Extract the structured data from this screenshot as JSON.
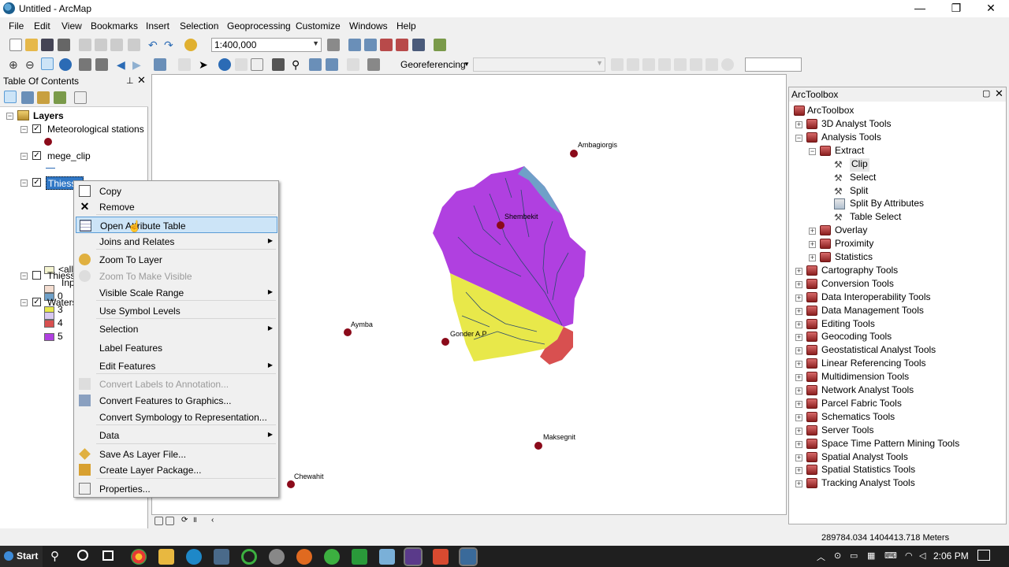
{
  "window": {
    "title": "Untitled - ArcMap",
    "minimize": "—",
    "restore": "❐",
    "close": "✕"
  },
  "menubar": [
    "File",
    "Edit",
    "View",
    "Bookmarks",
    "Insert",
    "Selection",
    "Geoprocessing",
    "Customize",
    "Windows",
    "Help"
  ],
  "toolbar": {
    "scale_value": "1:400,000",
    "georeferencing_label": "Georeferencing"
  },
  "toc": {
    "title": "Table Of Contents",
    "root": "Layers",
    "layers": [
      {
        "name": "Meteorological stations",
        "checked": true
      },
      {
        "name": "mege_clip",
        "checked": true
      },
      {
        "name": "Thiesse",
        "checked": true,
        "selected": true
      },
      {
        "name": "Thiesse",
        "checked": false
      },
      {
        "name": "Waters",
        "checked": true
      }
    ],
    "thiessen_sublabels": [
      "<all",
      "Inp"
    ],
    "legend_values": [
      "0",
      "3",
      "4",
      "5"
    ],
    "colors": {
      "v0": "#6fa0c8",
      "v3": "#e8e84a",
      "v4": "#d85050",
      "v5": "#b040e0"
    }
  },
  "context_menu": {
    "items": [
      {
        "label": "Copy",
        "icon": "copy-icon",
        "disabled": false,
        "submenu": false
      },
      {
        "label": "Remove",
        "icon": "remove-icon",
        "disabled": false,
        "submenu": false
      },
      {
        "label": "Open Attribute Table",
        "icon": "table-icon",
        "disabled": false,
        "submenu": false,
        "highlighted": true
      },
      {
        "label": "Joins and Relates",
        "icon": "",
        "disabled": false,
        "submenu": true
      },
      {
        "label": "Zoom To Layer",
        "icon": "zoom-layer-icon",
        "disabled": false,
        "submenu": false
      },
      {
        "label": "Zoom To Make Visible",
        "icon": "zoom-visible-icon",
        "disabled": true,
        "submenu": false
      },
      {
        "label": "Visible Scale Range",
        "icon": "",
        "disabled": false,
        "submenu": true
      },
      {
        "label": "Use Symbol Levels",
        "icon": "",
        "disabled": false,
        "submenu": false
      },
      {
        "label": "Selection",
        "icon": "",
        "disabled": false,
        "submenu": true
      },
      {
        "label": "Label Features",
        "icon": "",
        "disabled": false,
        "submenu": false
      },
      {
        "label": "Edit Features",
        "icon": "",
        "disabled": false,
        "submenu": true
      },
      {
        "label": "Convert Labels to Annotation...",
        "icon": "annotation-icon",
        "disabled": true,
        "submenu": false
      },
      {
        "label": "Convert Features to Graphics...",
        "icon": "graphics-icon",
        "disabled": false,
        "submenu": false
      },
      {
        "label": "Convert Symbology to Representation...",
        "icon": "",
        "disabled": false,
        "submenu": false
      },
      {
        "label": "Data",
        "icon": "",
        "disabled": false,
        "submenu": true
      },
      {
        "label": "Save As Layer File...",
        "icon": "layer-file-icon",
        "disabled": false,
        "submenu": false
      },
      {
        "label": "Create Layer Package...",
        "icon": "layer-package-icon",
        "disabled": false,
        "submenu": false
      },
      {
        "label": "Properties...",
        "icon": "properties-icon",
        "disabled": false,
        "submenu": false
      }
    ]
  },
  "map": {
    "stations": [
      "Ambagiorgis",
      "Shembekit",
      "Aymba",
      "Gonder A.P",
      "Maksegnit",
      "Chewahit"
    ]
  },
  "toolbox": {
    "title": "ArcToolbox",
    "root": "ArcToolbox",
    "items": [
      {
        "label": "3D Analyst Tools",
        "level": 1,
        "type": "toolbox",
        "expanded": false
      },
      {
        "label": "Analysis Tools",
        "level": 1,
        "type": "toolbox",
        "expanded": true
      },
      {
        "label": "Extract",
        "level": 2,
        "type": "toolset",
        "expanded": true
      },
      {
        "label": "Clip",
        "level": 3,
        "type": "tool",
        "highlight": true
      },
      {
        "label": "Select",
        "level": 3,
        "type": "tool"
      },
      {
        "label": "Split",
        "level": 3,
        "type": "tool"
      },
      {
        "label": "Split By Attributes",
        "level": 3,
        "type": "script"
      },
      {
        "label": "Table Select",
        "level": 3,
        "type": "tool"
      },
      {
        "label": "Overlay",
        "level": 2,
        "type": "toolset",
        "expanded": false
      },
      {
        "label": "Proximity",
        "level": 2,
        "type": "toolset",
        "expanded": false
      },
      {
        "label": "Statistics",
        "level": 2,
        "type": "toolset",
        "expanded": false
      },
      {
        "label": "Cartography Tools",
        "level": 1,
        "type": "toolbox",
        "expanded": false
      },
      {
        "label": "Conversion Tools",
        "level": 1,
        "type": "toolbox",
        "expanded": false
      },
      {
        "label": "Data Interoperability Tools",
        "level": 1,
        "type": "toolbox",
        "expanded": false
      },
      {
        "label": "Data Management Tools",
        "level": 1,
        "type": "toolbox",
        "expanded": false
      },
      {
        "label": "Editing Tools",
        "level": 1,
        "type": "toolbox",
        "expanded": false
      },
      {
        "label": "Geocoding Tools",
        "level": 1,
        "type": "toolbox",
        "expanded": false
      },
      {
        "label": "Geostatistical Analyst Tools",
        "level": 1,
        "type": "toolbox",
        "expanded": false
      },
      {
        "label": "Linear Referencing Tools",
        "level": 1,
        "type": "toolbox",
        "expanded": false
      },
      {
        "label": "Multidimension Tools",
        "level": 1,
        "type": "toolbox",
        "expanded": false
      },
      {
        "label": "Network Analyst Tools",
        "level": 1,
        "type": "toolbox",
        "expanded": false
      },
      {
        "label": "Parcel Fabric Tools",
        "level": 1,
        "type": "toolbox",
        "expanded": false
      },
      {
        "label": "Schematics Tools",
        "level": 1,
        "type": "toolbox",
        "expanded": false
      },
      {
        "label": "Server Tools",
        "level": 1,
        "type": "toolbox",
        "expanded": false
      },
      {
        "label": "Space Time Pattern Mining Tools",
        "level": 1,
        "type": "toolbox",
        "expanded": false
      },
      {
        "label": "Spatial Analyst Tools",
        "level": 1,
        "type": "toolbox",
        "expanded": false
      },
      {
        "label": "Spatial Statistics Tools",
        "level": 1,
        "type": "toolbox",
        "expanded": false
      },
      {
        "label": "Tracking Analyst Tools",
        "level": 1,
        "type": "toolbox",
        "expanded": false
      }
    ]
  },
  "status": {
    "coordinates": "289784.034  1404413.718 Meters"
  },
  "taskbar": {
    "start_label": "Start",
    "time": "2:06 PM"
  }
}
